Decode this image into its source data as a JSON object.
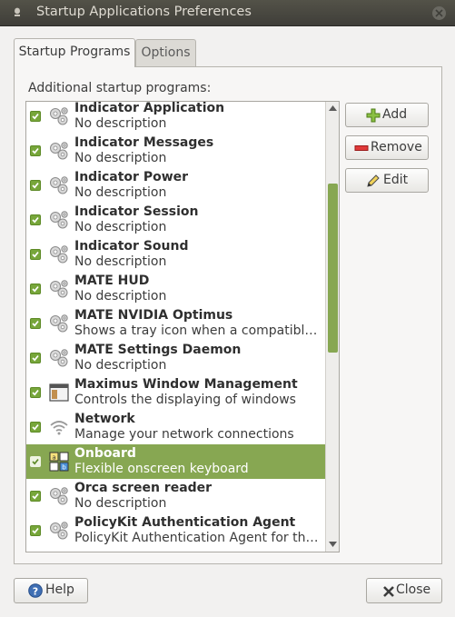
{
  "window": {
    "title": "Startup Applications Preferences"
  },
  "tabs": [
    {
      "label": "Startup Programs",
      "active": true
    },
    {
      "label": "Options",
      "active": false
    }
  ],
  "section_label": "Additional startup programs:",
  "programs": [
    {
      "name": "Indicator Application",
      "description": "No description",
      "enabled": true,
      "icon": "gears-icon"
    },
    {
      "name": "Indicator Messages",
      "description": "No description",
      "enabled": true,
      "icon": "gears-icon"
    },
    {
      "name": "Indicator Power",
      "description": "No description",
      "enabled": true,
      "icon": "gears-icon"
    },
    {
      "name": "Indicator Session",
      "description": "No description",
      "enabled": true,
      "icon": "gears-icon"
    },
    {
      "name": "Indicator Sound",
      "description": "No description",
      "enabled": true,
      "icon": "gears-icon"
    },
    {
      "name": "MATE HUD",
      "description": "No description",
      "enabled": true,
      "icon": "gears-icon"
    },
    {
      "name": "MATE NVIDIA Optimus",
      "description": "Shows a tray icon when a compatible N…",
      "enabled": true,
      "icon": "gears-icon"
    },
    {
      "name": "MATE Settings Daemon",
      "description": "No description",
      "enabled": true,
      "icon": "gears-icon"
    },
    {
      "name": "Maximus Window Management",
      "description": "Controls the displaying of windows",
      "enabled": true,
      "icon": "window-icon"
    },
    {
      "name": "Network",
      "description": "Manage your network connections",
      "enabled": true,
      "icon": "wifi-icon"
    },
    {
      "name": "Onboard",
      "description": "Flexible onscreen keyboard",
      "enabled": true,
      "selected": true,
      "icon": "keyboard-icon"
    },
    {
      "name": "Orca screen reader",
      "description": "No description",
      "enabled": true,
      "icon": "gears-icon"
    },
    {
      "name": "PolicyKit Authentication Agent",
      "description": "PolicyKit Authentication Agent for the …",
      "enabled": true,
      "icon": "gears-icon"
    }
  ],
  "buttons": {
    "add": "Add",
    "remove": "Remove",
    "edit": "Edit",
    "help": "Help",
    "close": "Close"
  },
  "colors": {
    "accent": "#87a752",
    "check": "#77a63a",
    "titlebar": "#3f3e39"
  }
}
